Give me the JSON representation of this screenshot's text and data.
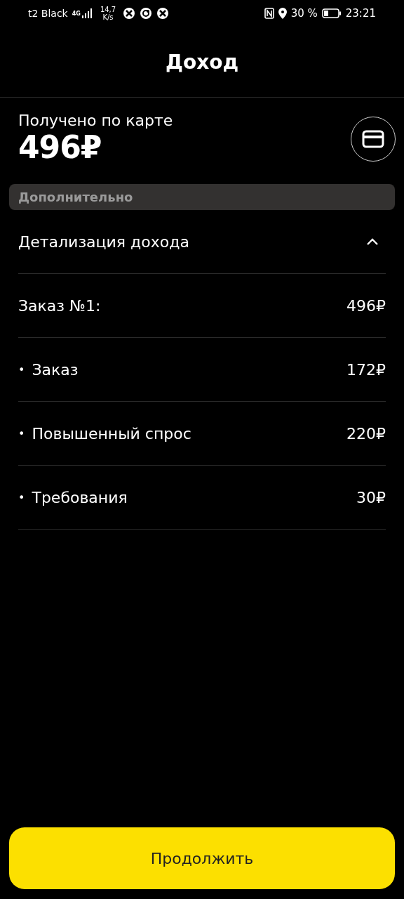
{
  "status_bar": {
    "carrier": "t2 Black",
    "network": "4G",
    "speed": "14,7",
    "speed_unit": "K/s",
    "battery": "30 %",
    "time": "23:21"
  },
  "header": {
    "title": "Доход"
  },
  "income": {
    "label": "Получено по карте",
    "amount": "496₽"
  },
  "section": {
    "title": "Дополнительно"
  },
  "details": {
    "title": "Детализация дохода",
    "expanded": true,
    "rows": [
      {
        "kind": "total",
        "label": "Заказ №1:",
        "value": "496₽"
      },
      {
        "kind": "item",
        "bullet": "•",
        "label": "Заказ",
        "value": "172₽"
      },
      {
        "kind": "item",
        "bullet": "•",
        "label": "Повышенный спрос",
        "value": "220₽"
      },
      {
        "kind": "item",
        "bullet": "•",
        "label": "Требования",
        "value": "30₽"
      }
    ]
  },
  "continue_button": {
    "label": "Продолжить"
  }
}
